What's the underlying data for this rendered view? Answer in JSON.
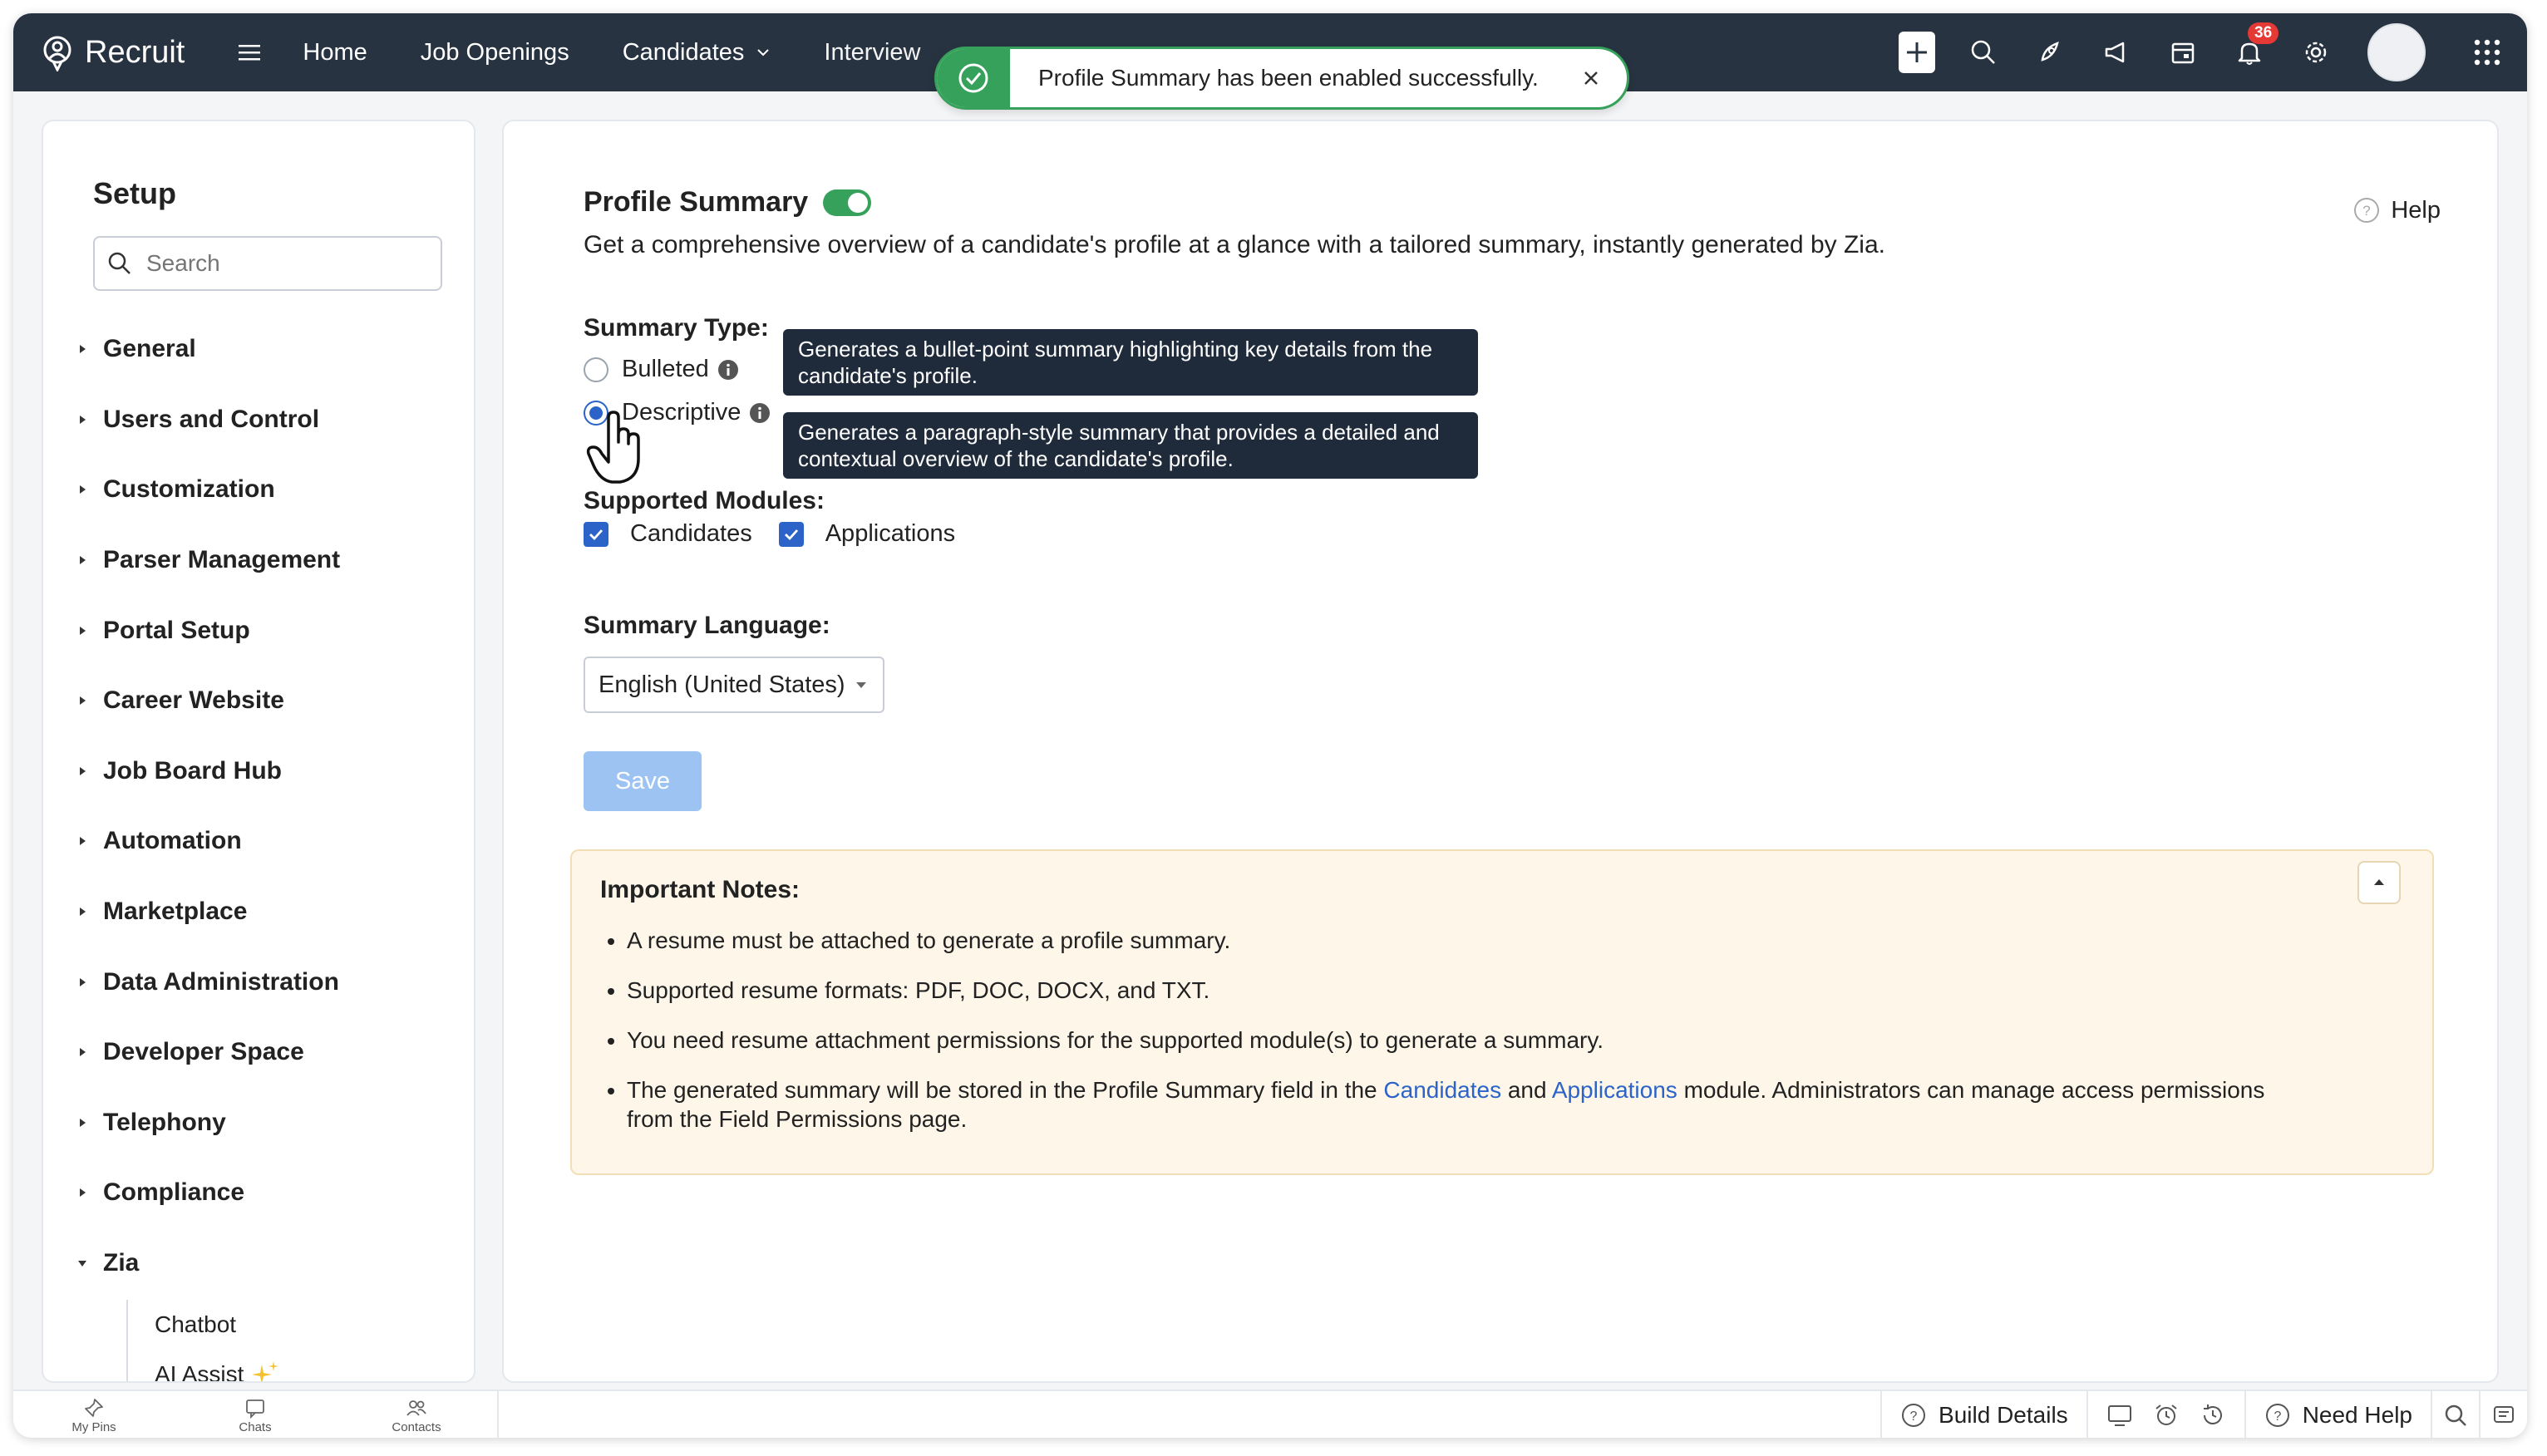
{
  "app": {
    "name": "Recruit"
  },
  "nav": {
    "items": [
      {
        "label": "Home"
      },
      {
        "label": "Job Openings"
      },
      {
        "label": "Candidates"
      },
      {
        "label": "Interview"
      }
    ]
  },
  "topbar": {
    "notification_count": "36"
  },
  "toast": {
    "message": "Profile Summary has been enabled successfully."
  },
  "sidebar": {
    "title": "Setup",
    "search_placeholder": "Search",
    "items": [
      {
        "label": "General"
      },
      {
        "label": "Users and Control"
      },
      {
        "label": "Customization"
      },
      {
        "label": "Parser Management"
      },
      {
        "label": "Portal Setup"
      },
      {
        "label": "Career Website"
      },
      {
        "label": "Job Board Hub"
      },
      {
        "label": "Automation"
      },
      {
        "label": "Marketplace"
      },
      {
        "label": "Data Administration"
      },
      {
        "label": "Developer Space"
      },
      {
        "label": "Telephony"
      },
      {
        "label": "Compliance"
      },
      {
        "label": "Zia"
      }
    ],
    "zia_sub": [
      {
        "label": "Chatbot"
      },
      {
        "label": "AI Assist"
      }
    ]
  },
  "main": {
    "title": "Profile Summary",
    "enabled": true,
    "description": "Get a comprehensive overview of a candidate's profile at a glance with a tailored summary, instantly generated by Zia.",
    "help_label": "Help",
    "summary_type_label": "Summary Type:",
    "types": [
      {
        "label": "Bulleted",
        "selected": false,
        "tooltip": "Generates a bullet-point summary highlighting key details from the candidate's profile."
      },
      {
        "label": "Descriptive",
        "selected": true,
        "tooltip": "Generates a paragraph-style summary that provides a detailed and contextual overview of the candidate's profile."
      }
    ],
    "modules_label": "Supported Modules:",
    "modules": [
      {
        "label": "Candidates",
        "checked": true
      },
      {
        "label": "Applications",
        "checked": true
      }
    ],
    "language_label": "Summary Language:",
    "language_value": "English (United States)",
    "save_label": "Save",
    "notes": {
      "title": "Important Notes:",
      "items": [
        "A resume must be attached to generate a profile summary.",
        "Supported resume formats: PDF, DOC, DOCX, and TXT.",
        "You need resume attachment permissions for the supported module(s) to generate a summary."
      ],
      "last": {
        "pre": "The generated summary will be stored in the Profile Summary field in the ",
        "link1": "Candidates",
        "mid": " and ",
        "link2": "Applications",
        "post": " module. Administrators can manage access permissions from the Field Permissions page."
      }
    }
  },
  "bottombar": {
    "left": [
      {
        "label": "My Pins"
      },
      {
        "label": "Chats"
      },
      {
        "label": "Contacts"
      }
    ],
    "build_details": "Build Details",
    "need_help": "Need Help"
  },
  "colors": {
    "topbar": "#283341",
    "accent": "#36a15b",
    "link": "#2b63c8",
    "notes_bg": "#fdf6e9"
  }
}
